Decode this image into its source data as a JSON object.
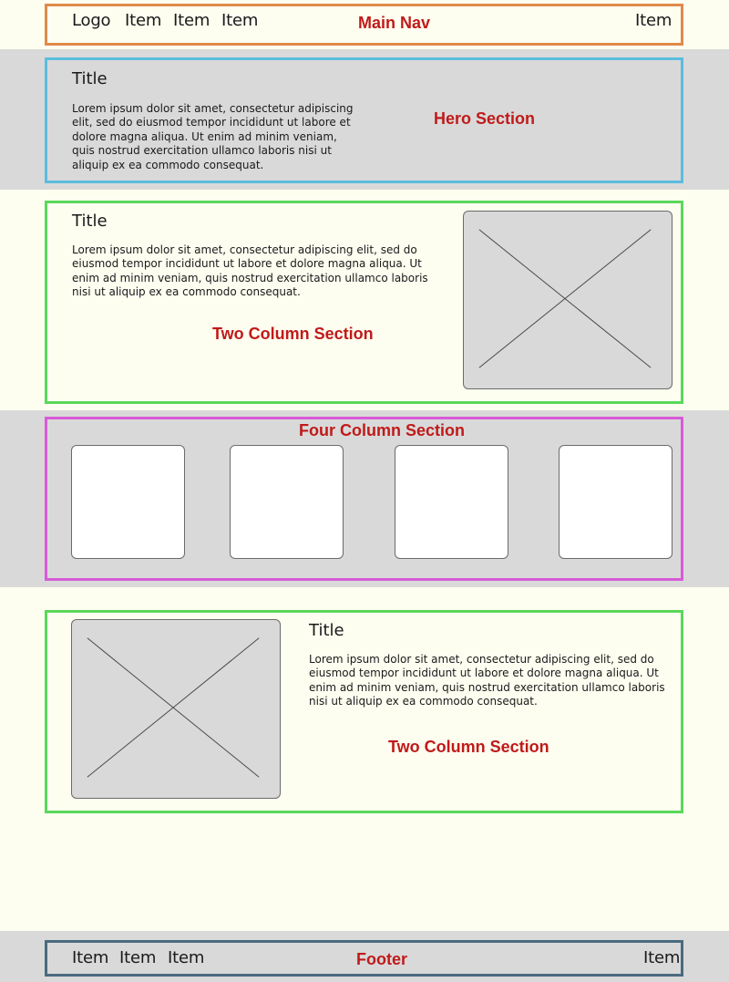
{
  "main_nav": {
    "label": "Main Nav",
    "logo": "Logo",
    "left_items": [
      "Item",
      "Item",
      "Item"
    ],
    "right_item": "Item",
    "frame_color": "#e08a4a"
  },
  "hero": {
    "label": "Hero Section",
    "title": "Title",
    "body": "Lorem ipsum dolor sit amet, consectetur adipiscing elit, sed do eiusmod tempor incididunt ut labore et dolore magna aliqua. Ut enim ad minim veniam, quis nostrud exercitation ullamco laboris nisi ut aliquip ex ea commodo consequat.",
    "frame_color": "#5bbde0"
  },
  "two_column_1": {
    "label": "Two Column Section",
    "title": "Title",
    "body": "Lorem ipsum dolor sit amet, consectetur adipiscing elit, sed do eiusmod tempor incididunt ut labore et dolore magna aliqua. Ut enim ad minim veniam, quis nostrud exercitation ullamco laboris nisi ut aliquip ex ea commodo consequat.",
    "image": "image-placeholder-icon",
    "frame_color": "#5ad85a"
  },
  "four_column": {
    "label": "Four Column Section",
    "cards": [
      {
        "name": "card-1"
      },
      {
        "name": "card-2"
      },
      {
        "name": "card-3"
      },
      {
        "name": "card-4"
      }
    ],
    "frame_color": "#d85ad8"
  },
  "two_column_2": {
    "label": "Two Column Section",
    "title": "Title",
    "body": "Lorem ipsum dolor sit amet, consectetur adipiscing elit, sed do eiusmod tempor incididunt ut labore et dolore magna aliqua. Ut enim ad minim veniam, quis nostrud exercitation ullamco laboris nisi ut aliquip ex ea commodo consequat.",
    "image": "image-placeholder-icon",
    "frame_color": "#5ad85a"
  },
  "footer": {
    "label": "Footer",
    "left_items": [
      "Item",
      "Item",
      "Item"
    ],
    "right_item": "Item",
    "frame_color": "#4a6a80"
  },
  "colors": {
    "label_red": "#c01a1a",
    "band_grey": "#d9d9d9",
    "band_cream": "#fdfdf0"
  }
}
